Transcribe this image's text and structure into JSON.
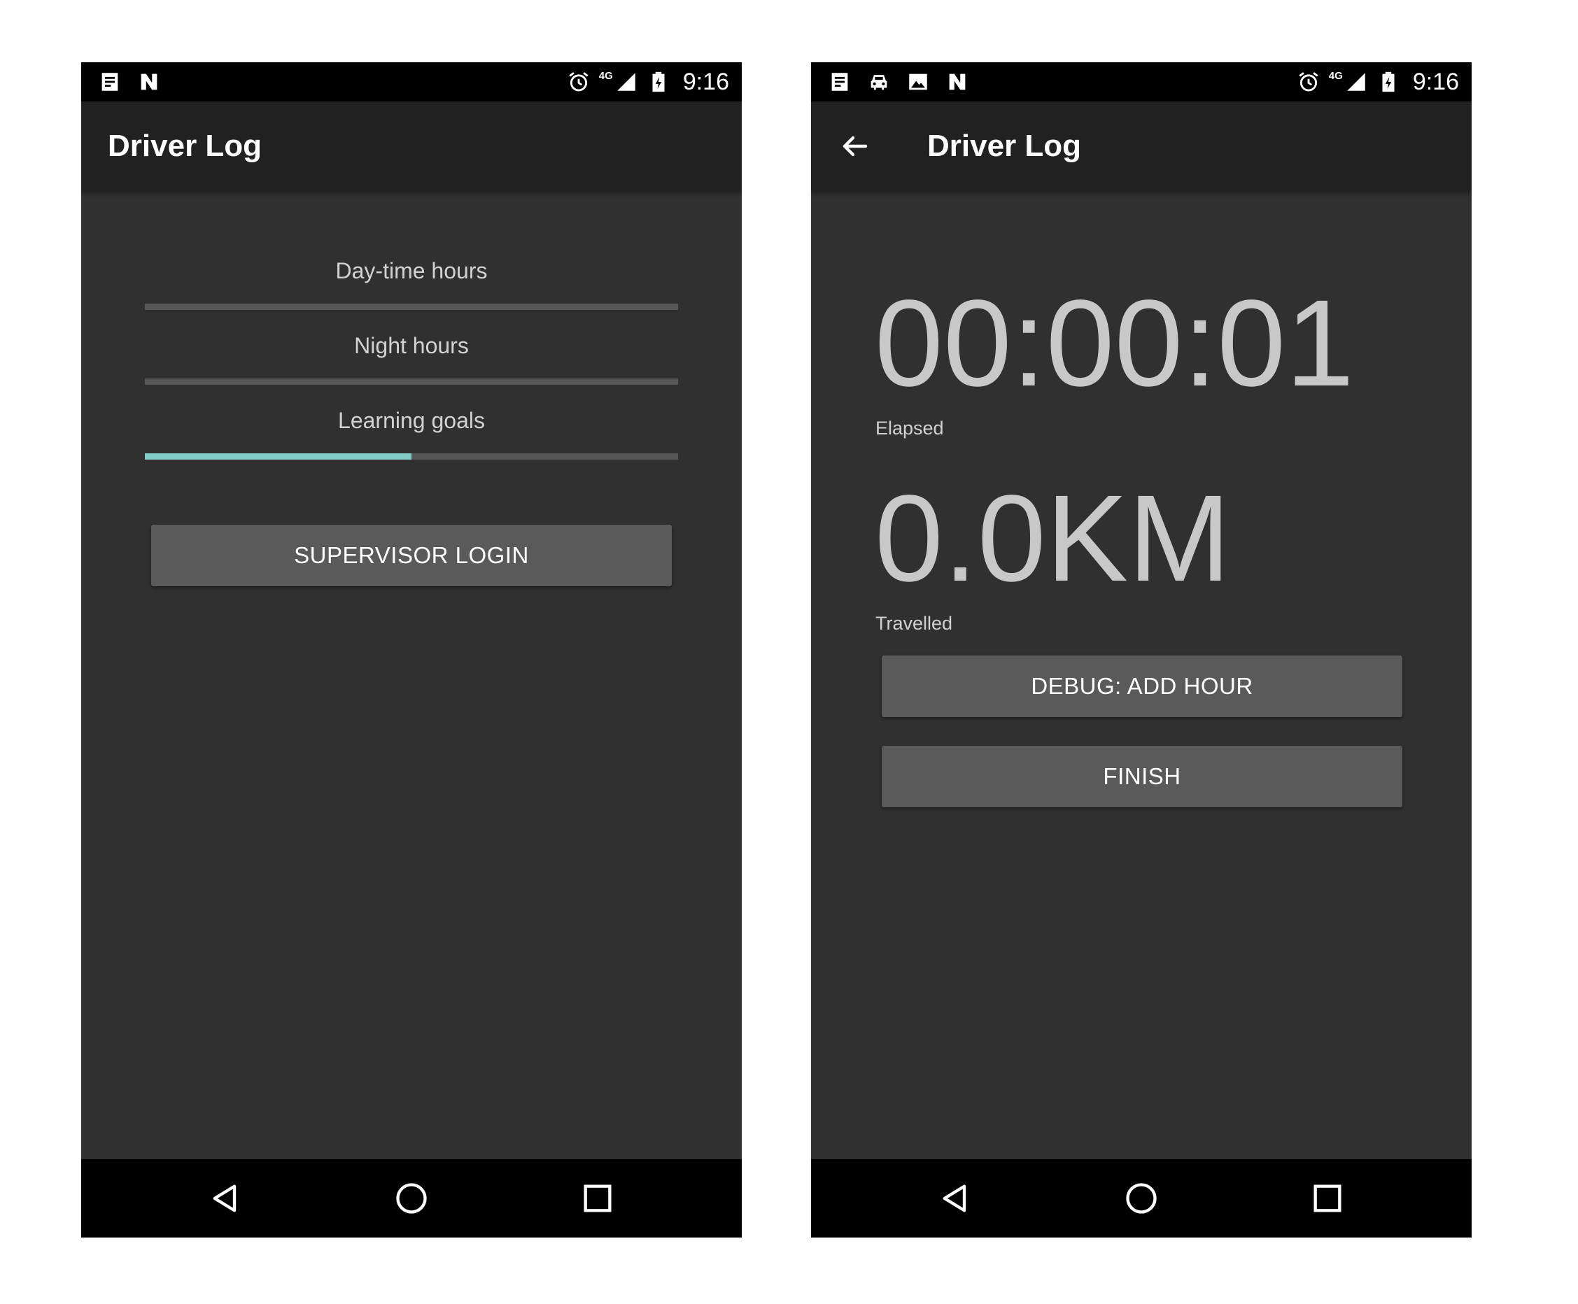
{
  "status_bar": {
    "time": "9:16",
    "network": "4G",
    "left_icons": [
      "document-icon",
      "n-icon"
    ],
    "right_icons": [
      "alarm-icon",
      "signal-icon",
      "battery-charging-icon"
    ]
  },
  "status_bar_right": {
    "time": "9:16",
    "network": "4G",
    "left_icons": [
      "document-icon",
      "car-icon",
      "image-icon",
      "n-icon"
    ]
  },
  "left_screen": {
    "app_title": "Driver Log",
    "progress": [
      {
        "label": "Day-time hours",
        "fraction": 0
      },
      {
        "label": "Night hours",
        "fraction": 0
      },
      {
        "label": "Learning goals",
        "fraction": 0.5
      }
    ],
    "supervisor_login_label": "SUPERVISOR LOGIN"
  },
  "right_screen": {
    "app_title": "Driver Log",
    "elapsed_value": "00:00:01",
    "elapsed_caption": "Elapsed",
    "distance_value": "0.0KM",
    "distance_caption": "Travelled",
    "debug_label": "DEBUG: ADD HOUR",
    "finish_label": "FINISH"
  },
  "colors": {
    "background": "#303030",
    "app_bar": "#212121",
    "accent": "#80cbc4",
    "track": "#565656",
    "button": "#5a5a5b"
  },
  "nav_bar": {
    "icons": [
      "back-triangle-icon",
      "home-circle-icon",
      "recents-square-icon"
    ]
  }
}
